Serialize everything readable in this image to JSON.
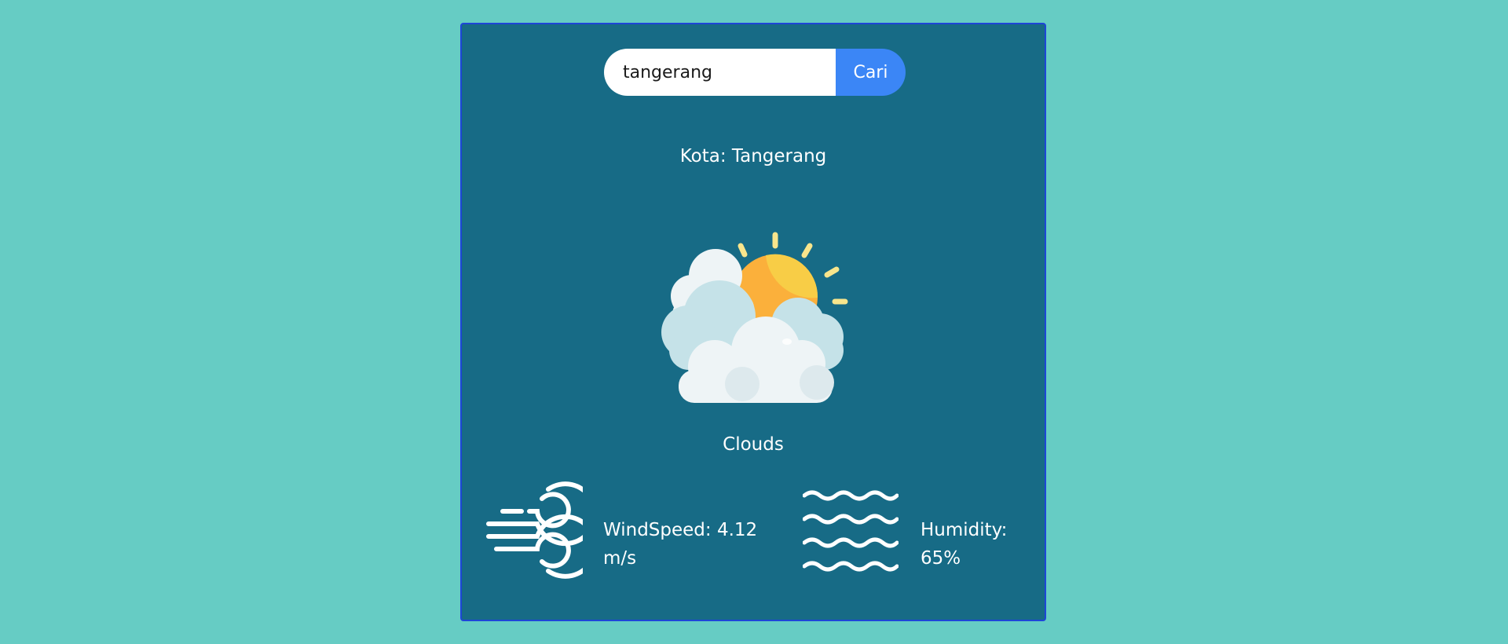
{
  "search": {
    "value": "tangerang",
    "button_label": "Cari"
  },
  "location": {
    "city_text": "Kota: Tangerang"
  },
  "weather": {
    "icon": "sun-behind-clouds-icon",
    "condition": "Clouds"
  },
  "stats": {
    "wind": {
      "icon": "wind-icon",
      "label_line1": "WindSpeed: 4.12",
      "label_line2": "m/s"
    },
    "humidity": {
      "icon": "humidity-waves-icon",
      "label_line1": "Humidity:",
      "label_line2": "65%"
    }
  },
  "colors": {
    "page_background": "#66ccc4",
    "card_background": "#176b86",
    "card_border": "#1e45d8",
    "button": "#3b86f6",
    "text": "#ffffff"
  }
}
